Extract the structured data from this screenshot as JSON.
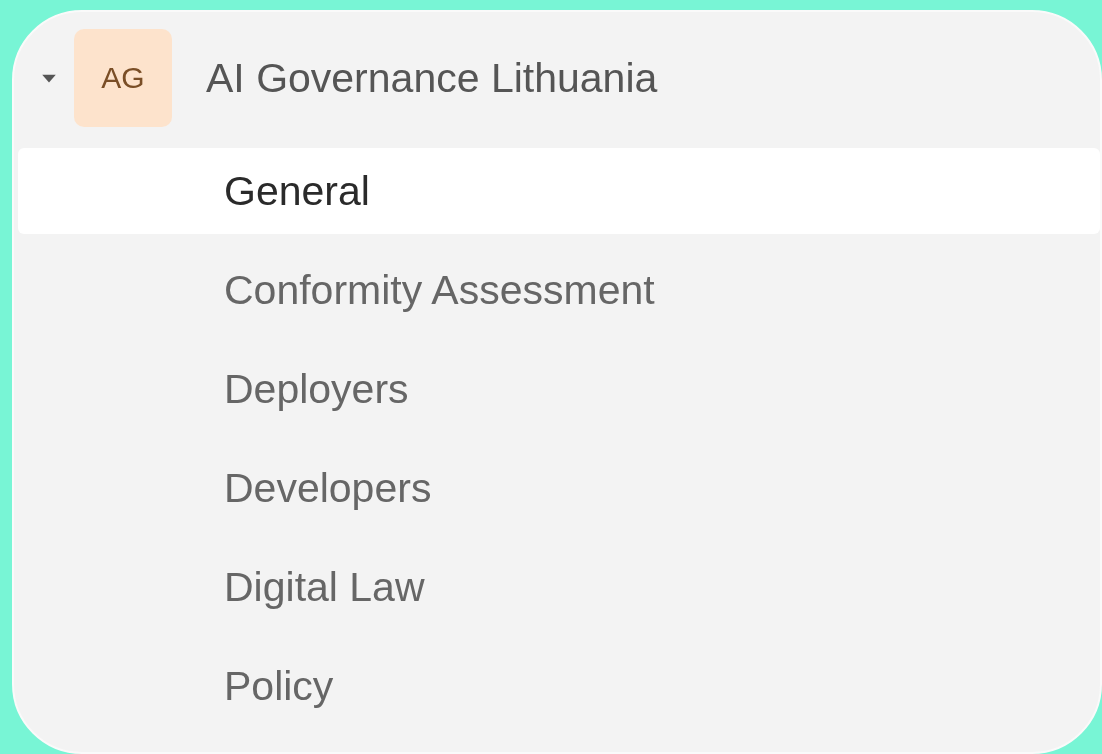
{
  "tree": {
    "avatar": "AG",
    "label": "AI Governance Lithuania",
    "expanded": true,
    "children": [
      {
        "label": "General",
        "selected": true
      },
      {
        "label": "Conformity Assessment",
        "selected": false
      },
      {
        "label": "Deployers",
        "selected": false
      },
      {
        "label": "Developers",
        "selected": false
      },
      {
        "label": "Digital Law",
        "selected": false
      },
      {
        "label": "Policy",
        "selected": false
      }
    ]
  }
}
